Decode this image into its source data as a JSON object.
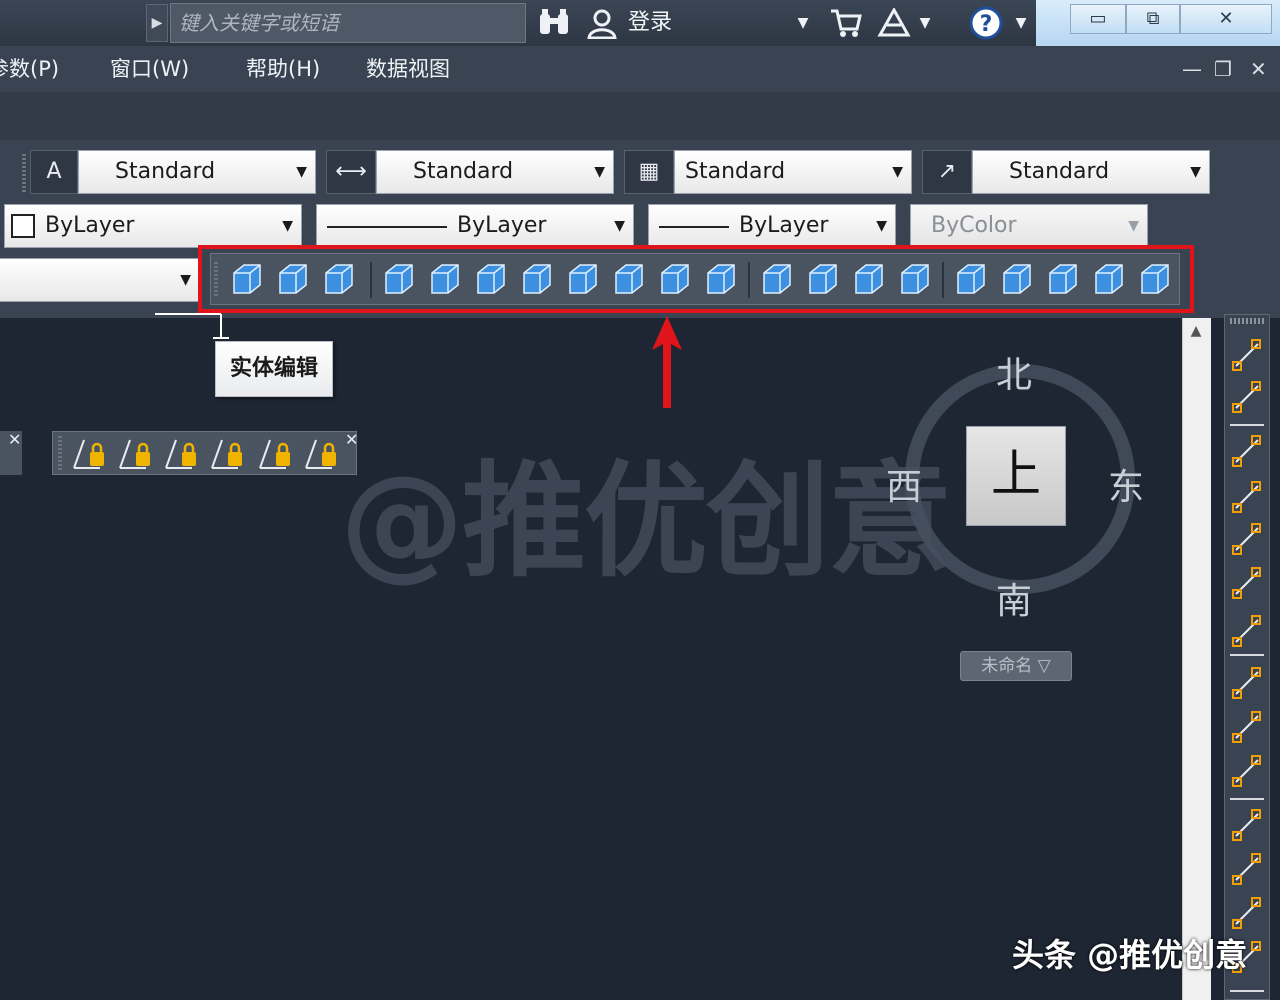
{
  "titlebar": {
    "search_placeholder": "键入关键字或短语",
    "login_label": "登录",
    "icons": [
      "search-arrow-icon",
      "binoculars-icon",
      "user-icon",
      "cart-icon",
      "exchange-icon",
      "help-icon",
      "minimize-icon",
      "restore-icon",
      "close-icon"
    ],
    "window_buttons": {
      "minimize": "▭",
      "restore": "⧉",
      "close": "✕"
    }
  },
  "menu": {
    "items": [
      {
        "label": "参数(P)"
      },
      {
        "label": "窗口(W)"
      },
      {
        "label": "帮助(H)"
      },
      {
        "label": "数据视图"
      }
    ],
    "mdi_buttons": {
      "minimize": "—",
      "restore": "❐",
      "close": "✕"
    }
  },
  "styles_toolbar": {
    "text_style": "Standard",
    "dim_style": "Standard",
    "table_style": "Standard",
    "mleader_style": "Standard"
  },
  "properties_toolbar": {
    "color": "ByLayer",
    "linetype": "ByLayer",
    "lineweight": "ByLayer",
    "plotstyle": "ByColor"
  },
  "solid_editing_toolbar": {
    "tooltip": "实体编辑",
    "highlight_color": "#e0141b"
  },
  "viewcube": {
    "north": "北",
    "south": "南",
    "east": "东",
    "west": "西",
    "face": "上",
    "wcs_label": "未命名 ▽"
  },
  "watermark": "@推优创意",
  "footer_mark": "头条 @推优创意"
}
